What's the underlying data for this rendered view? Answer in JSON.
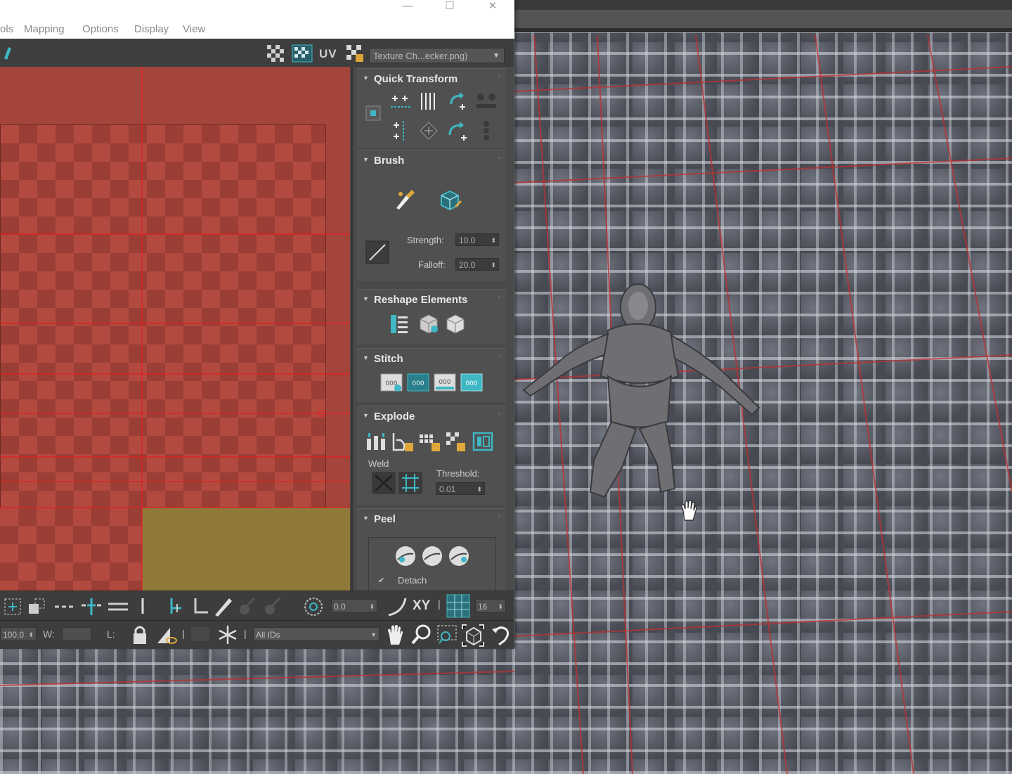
{
  "window": {
    "controls": {
      "minimize": "—",
      "maximize": "☐",
      "close": "✕"
    }
  },
  "menu": {
    "items": [
      "ols",
      "Mapping",
      "Options",
      "Display",
      "View"
    ]
  },
  "toolbar": {
    "uv_label": "UV",
    "texture_select": "Texture Ch...ecker.png)"
  },
  "rollout": {
    "quick_transform": {
      "title": "Quick Transform"
    },
    "brush": {
      "title": "Brush",
      "strength_label": "Strength:",
      "strength_value": "10.0",
      "falloff_label": "Falloff:",
      "falloff_value": "20.0"
    },
    "reshape": {
      "title": "Reshape Elements"
    },
    "stitch": {
      "title": "Stitch"
    },
    "explode": {
      "title": "Explode",
      "weld_label": "Weld",
      "threshold_label": "Threshold:",
      "threshold_value": "0.01"
    },
    "peel": {
      "title": "Peel",
      "detach_label": "Detach"
    }
  },
  "bottom_bar": {
    "rotation_value": "0.0",
    "xy_label": "XY",
    "grid_value": "16",
    "u_value": "100.0",
    "w_label": "W:",
    "l_label": "L:",
    "ids_select": "All IDs"
  },
  "colors": {
    "uv_background": "#a4453c",
    "uv_seam_lines": "#e02020",
    "selected_face": "#8f7a3a",
    "panel_bg": "#4a4a4a",
    "accent_teal": "#3fb7c4"
  }
}
